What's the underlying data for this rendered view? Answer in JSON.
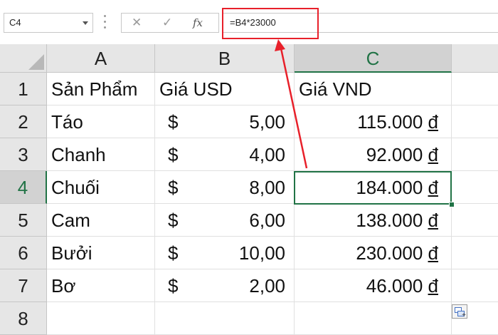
{
  "formula_bar": {
    "name_box": "C4",
    "formula": "=B4*23000",
    "cancel_icon": "✕",
    "enter_icon": "✓",
    "fx_label": "fx"
  },
  "columns": [
    "A",
    "B",
    "C"
  ],
  "rows": [
    "1",
    "2",
    "3",
    "4",
    "5",
    "6",
    "7",
    "8"
  ],
  "selected_cell": "C4",
  "cells": {
    "header": {
      "a": "Sản Phẩm",
      "b": "Giá USD",
      "c": "Giá VND"
    },
    "data": [
      {
        "product": "Táo",
        "currency": "$",
        "usd": "5,00",
        "vnd": "115.000",
        "dong": "đ"
      },
      {
        "product": "Chanh",
        "currency": "$",
        "usd": "4,00",
        "vnd": "92.000",
        "dong": "đ"
      },
      {
        "product": "Chuối",
        "currency": "$",
        "usd": "8,00",
        "vnd": "184.000",
        "dong": "đ"
      },
      {
        "product": "Cam",
        "currency": "$",
        "usd": "6,00",
        "vnd": "138.000",
        "dong": "đ"
      },
      {
        "product": "Bưởi",
        "currency": "$",
        "usd": "10,00",
        "vnd": "230.000",
        "dong": "đ"
      },
      {
        "product": "Bơ",
        "currency": "$",
        "usd": "2,00",
        "vnd": "46.000",
        "dong": "đ"
      }
    ]
  },
  "colors": {
    "accent_green": "#217346",
    "annotation_red": "#e8202a",
    "header_gray": "#e6e6e6"
  },
  "icons": {
    "paste_options": "paste-options-icon",
    "cancel": "x-icon",
    "enter": "check-icon",
    "function": "fx-icon"
  }
}
